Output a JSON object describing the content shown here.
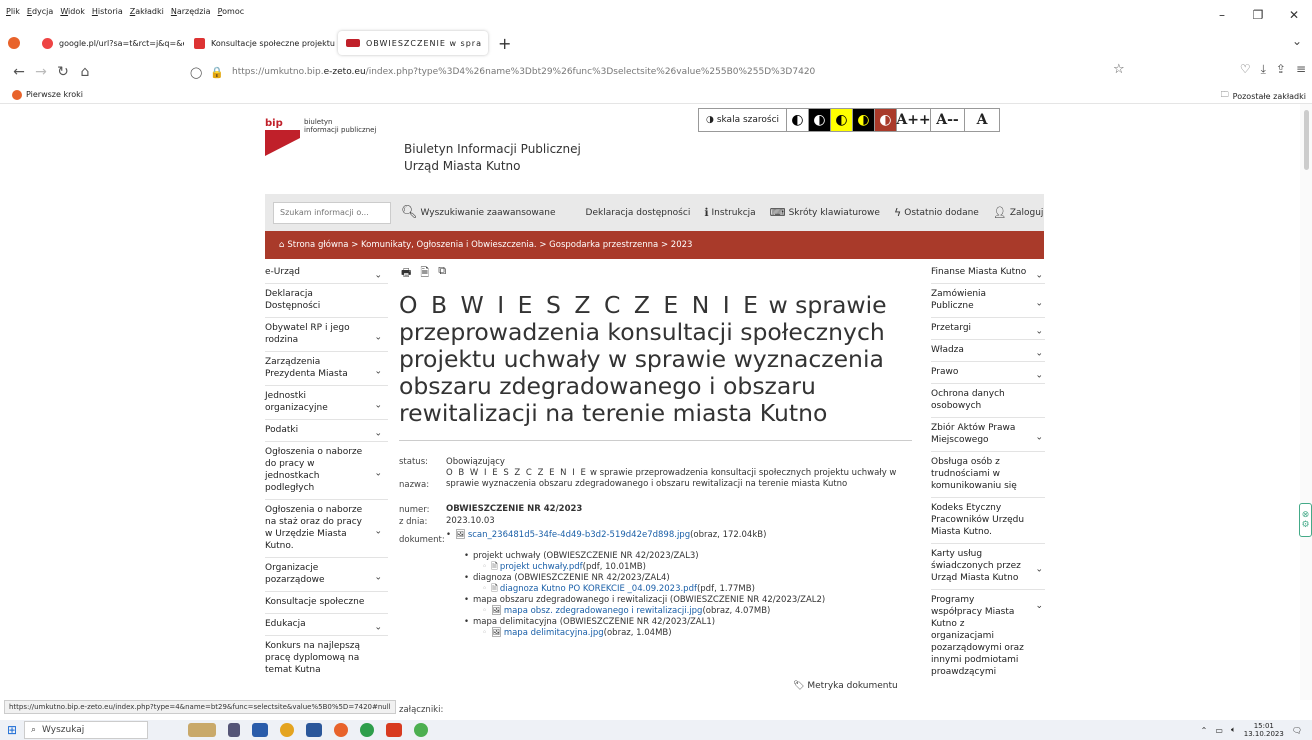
{
  "browser": {
    "menu": [
      "Plik",
      "Edycja",
      "Widok",
      "Historia",
      "Zakładki",
      "Narzędzia",
      "Pomoc"
    ],
    "tabs": [
      {
        "label": "google.pl/url?sa=t&rct=j&q=&esrc",
        "active": false,
        "icon_color": "#e44"
      },
      {
        "label": "Konsultacje społeczne projektu",
        "active": false,
        "icon_color": "#d33"
      },
      {
        "label": "OBWIESZCZENIE w spra",
        "active": true,
        "icon_color": "#c0202a"
      }
    ],
    "url_prefix": "https://umkutno.bip.",
    "url_domain": "e-zeto.eu",
    "url_suffix": "/index.php?type%3D4%26name%3Dbt29%26func%3Dselectsite%26value%255B0%255D%3D7420",
    "bookmarks_first": "Pierwsze kroki",
    "bookmarks_other": "Pozostałe zakładki",
    "status_url": "https://umkutno.bip.e-zeto.eu/index.php?type=4&name=bt29&func=selectsite&value%5B0%5D=7420#null"
  },
  "header": {
    "logo_bip": "bip",
    "logo_line1": "biuletyn",
    "logo_line2": "informacji publicznej",
    "site_line1": "Biuletyn Informacji Publicznej",
    "site_line2": "Urząd Miasta Kutno",
    "grayscale_label": "skala szarości",
    "font_plus": "A++",
    "font_minus": "A--",
    "font_reset": "A"
  },
  "toolbar": {
    "search_placeholder": "Szukam informacji o...",
    "advanced_search": "Wyszukiwanie zaawansowane",
    "accessibility_declaration": "Deklaracja dostępności",
    "instructions": "Instrukcja",
    "shortcuts": "Skróty klawiaturowe",
    "recently_added": "Ostatnio dodane",
    "login": "Zaloguj"
  },
  "breadcrumb": "Strona główna > Komunikaty, Ogłoszenia i Obwieszczenia. > Gospodarka przestrzenna > 2023",
  "left_nav": [
    {
      "label": "e-Urząd",
      "chevron": true
    },
    {
      "label": "Deklaracja Dostępności",
      "chevron": false
    },
    {
      "label": "Obywatel RP i jego rodzina",
      "chevron": true
    },
    {
      "label": "Zarządzenia Prezydenta Miasta",
      "chevron": true
    },
    {
      "label": "Jednostki organizacyjne",
      "chevron": true
    },
    {
      "label": "Podatki",
      "chevron": true
    },
    {
      "label": "Ogłoszenia o naborze do pracy w jednostkach podległych",
      "chevron": true
    },
    {
      "label": "Ogłoszenia o naborze na staż oraz do pracy w Urzędzie Miasta Kutno.",
      "chevron": true
    },
    {
      "label": "Organizacje pozarządowe",
      "chevron": true
    },
    {
      "label": "Konsultacje społeczne",
      "chevron": false
    },
    {
      "label": "Edukacja",
      "chevron": true
    },
    {
      "label": "Konkurs na najlepszą pracę dyplomową na temat Kutna",
      "chevron": false
    }
  ],
  "right_nav": [
    {
      "label": "Finanse Miasta Kutno",
      "chevron": true
    },
    {
      "label": "Zamówienia Publiczne",
      "chevron": true
    },
    {
      "label": "Przetargi",
      "chevron": true
    },
    {
      "label": "Władza",
      "chevron": true
    },
    {
      "label": "Prawo",
      "chevron": true
    },
    {
      "label": "Ochrona danych osobowych",
      "chevron": false
    },
    {
      "label": "Zbiór Aktów Prawa Miejscowego",
      "chevron": true
    },
    {
      "label": "Obsługa osób z trudnościami w komunikowaniu się",
      "chevron": false
    },
    {
      "label": "Kodeks Etyczny Pracowników Urzędu Miasta Kutno.",
      "chevron": false
    },
    {
      "label": "Karty usług świadczonych przez Urząd Miasta Kutno",
      "chevron": true
    },
    {
      "label": "Programy współpracy Miasta Kutno z organizacjami pozarządowymi oraz innymi podmiotami proawdzącymi",
      "chevron": true
    }
  ],
  "document": {
    "title_spaced": "O B W I E S Z C Z E N I E",
    "title_rest": " w sprawie przeprowadzenia konsultacji społecznych projektu uchwały w sprawie wyznaczenia obszaru zdegradowanego i obszaru rewitalizacji na terenie miasta Kutno",
    "labels": {
      "status": "status:",
      "name": "nazwa:",
      "number": "numer:",
      "date": "z dnia:",
      "document": "dokument:",
      "attachments": "załączniki:"
    },
    "status": "Obowiązujący",
    "name_spaced": "O B W I E S Z C Z E N I E",
    "name_rest": " w sprawie przeprowadzenia konsultacji społecznych projektu uchwały w sprawie wyznaczenia obszaru zdegradowanego i obszaru rewitalizacji na terenie miasta Kutno",
    "number": "OBWIESZCZENIE NR 42/2023",
    "date": "2023.10.03",
    "doc_file": "scan_236481d5-34fe-4d49-b3d2-519d42e7d898.jpg",
    "doc_file_info": " (obraz, 172.04kB)",
    "attachments": [
      {
        "title": "projekt uchwały (OBWIESZCZENIE NR 42/2023/ZAL3)",
        "file": "projekt uchwały.pdf",
        "info": " (pdf, 10.01MB)"
      },
      {
        "title": "diagnoza (OBWIESZCZENIE NR 42/2023/ZAL4)",
        "file": "diagnoza Kutno PO KOREKCIE _04.09.2023.pdf",
        "info": " (pdf, 1.77MB)"
      },
      {
        "title": "mapa obszaru zdegradowanego i rewitalizacji (OBWIESZCZENIE NR 42/2023/ZAL2)",
        "file": "mapa obsz. zdegradowanego i rewitalizacji.jpg",
        "info": " (obraz, 4.07MB)"
      },
      {
        "title": "mapa delimitacyjna (OBWIESZCZENIE NR 42/2023/ZAL1)",
        "file": "mapa delimitacyjna.jpg",
        "info": " (obraz, 1.04MB)"
      }
    ],
    "metryka": "Metryka dokumentu"
  },
  "taskbar": {
    "search_label": "Wyszukaj",
    "time": "15:01",
    "date": "13.10.2023"
  },
  "colors": {
    "accent": "#a93a2a",
    "bip_red": "#c0202a",
    "link": "#1a5fa8",
    "search_bar_bg": "#e9e9e9"
  }
}
